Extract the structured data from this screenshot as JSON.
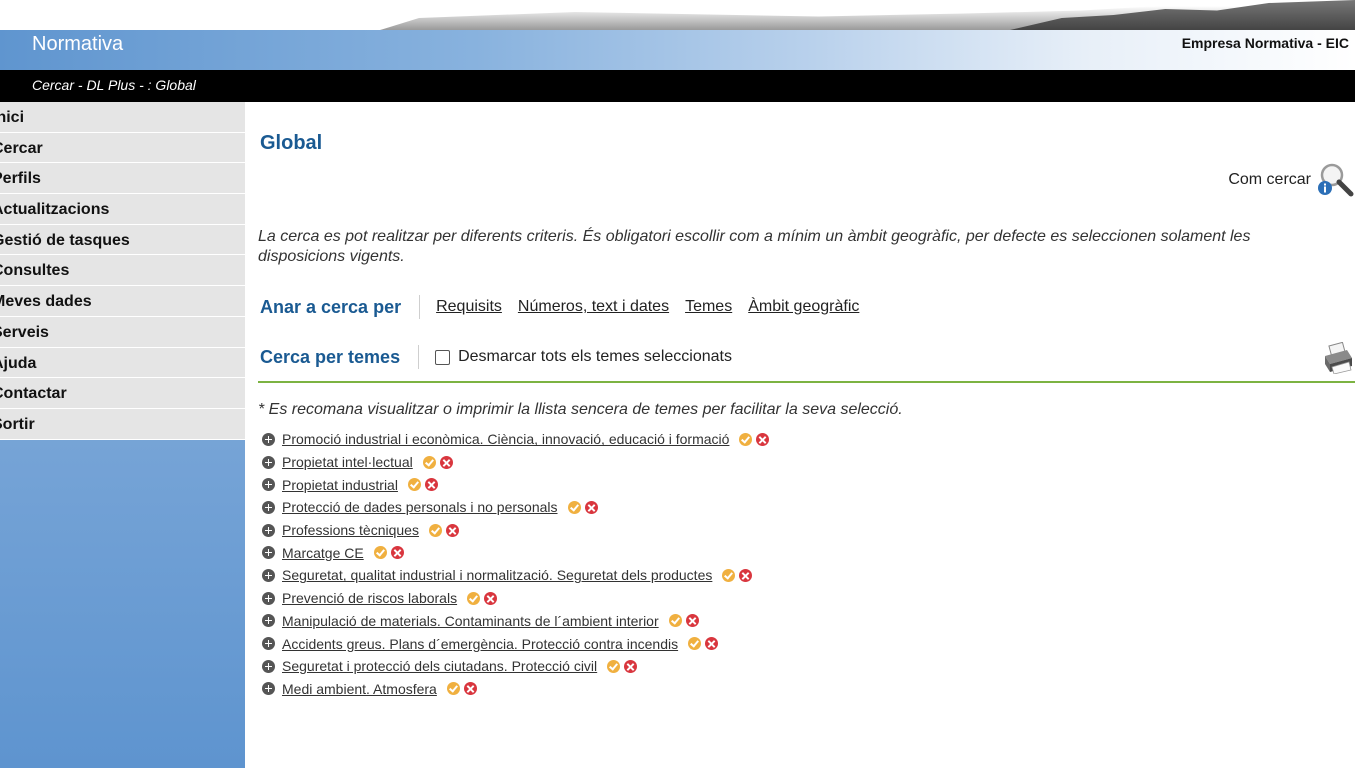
{
  "header": {
    "app_title": "Normativa",
    "company": "Empresa Normativa - EIC",
    "breadcrumb": "Cercar - DL Plus - : Global"
  },
  "sidebar": {
    "items": [
      {
        "label": "Inici"
      },
      {
        "label": "Cercar"
      },
      {
        "label": "Perfils"
      },
      {
        "label": "Actualitzacions"
      },
      {
        "label": "Gestió de tasques"
      },
      {
        "label": "Consultes"
      },
      {
        "label": "Meves dades"
      },
      {
        "label": "Serveis"
      },
      {
        "label": "Ajuda"
      },
      {
        "label": "Contactar"
      },
      {
        "label": "Sortir"
      }
    ]
  },
  "main": {
    "page_title": "Global",
    "help_label": "Com cercar",
    "intro": "La cerca es pot realitzar per diferents criteris. És obligatori escollir com a mínim un àmbit geogràfic, per defecte es seleccionen solament les disposicions vigents.",
    "goto": {
      "heading": "Anar a cerca per",
      "links": [
        "Requisits",
        "Números, text i dates",
        "Temes",
        "Àmbit geogràfic"
      ]
    },
    "themes": {
      "heading": "Cerca per temes",
      "uncheck_label": "Desmarcar tots els temes seleccionats",
      "uncheck_checked": false
    },
    "note": "* Es recomana visualitzar o imprimir la llista sencera de temes per facilitar la seva selecció.",
    "topics": [
      "Promoció industrial i econòmica. Ciència, innovació, educació i formació",
      "Propietat intel·lectual",
      "Propietat industrial",
      "Protecció de dades personals i no personals",
      "Professions tècniques",
      "Marcatge CE",
      "Seguretat, qualitat industrial i normalització. Seguretat dels productes",
      "Prevenció de riscos laborals",
      "Manipulació de materials. Contaminants de l´ambient interior",
      "Accidents greus. Plans d´emergència. Protecció contra incendis",
      "Seguretat i protecció dels ciutadans. Protecció civil",
      "Medi ambient. Atmosfera"
    ]
  },
  "colors": {
    "accent_blue": "#1a5a92",
    "header_gradient_start": "#5f95cf",
    "rule_green": "#7cb342",
    "ok_orange": "#f0b040",
    "remove_red": "#d9363e"
  }
}
